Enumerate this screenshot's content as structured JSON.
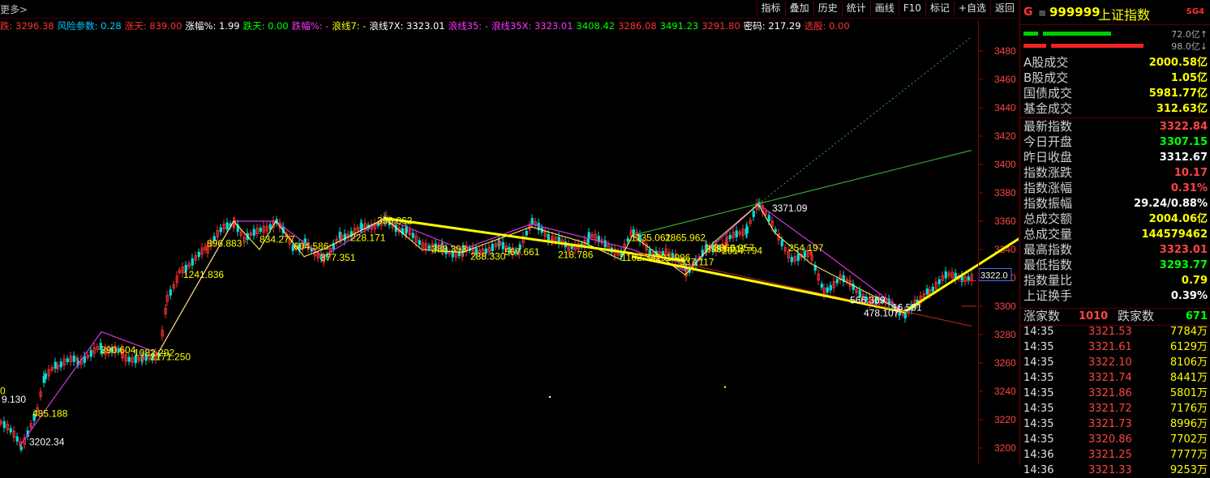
{
  "topbar": {
    "more_label": "更多>",
    "toolbar": [
      "指标",
      "叠加",
      "历史",
      "统计",
      "画线",
      "F10",
      "标记",
      "+自选",
      "返回"
    ]
  },
  "indicator_row": [
    {
      "text": "跌: 3296.38",
      "color": "#ff3333"
    },
    {
      "text": "风险参数: 0.28",
      "color": "#00ccff"
    },
    {
      "text": "涨天: 839.00",
      "color": "#ff3333"
    },
    {
      "text": "涨幅%: 1.99",
      "color": "#ffffff"
    },
    {
      "text": "跌天: 0.00",
      "color": "#00ff00"
    },
    {
      "text": "跌幅%: -",
      "color": "#ff33ff"
    },
    {
      "text": "浪线7: -",
      "color": "#ffff00"
    },
    {
      "text": "浪线7X: 3323.01",
      "color": "#ffffff"
    },
    {
      "text": "浪线35: -",
      "color": "#ff33ff"
    },
    {
      "text": "浪线35X: 3323.01",
      "color": "#ff33ff"
    },
    {
      "text": "3408.42",
      "color": "#00ff00"
    },
    {
      "text": "3286.08",
      "color": "#ff3333"
    },
    {
      "text": "3491.23",
      "color": "#00ff00"
    },
    {
      "text": "3291.80",
      "color": "#ff3333"
    },
    {
      "text": "密码: 217.29",
      "color": "#ffffff"
    },
    {
      "text": "选股: 0.00",
      "color": "#ff3333"
    }
  ],
  "price_axis": {
    "ticks": [
      "3480",
      "3460",
      "3440",
      "3420",
      "3400",
      "3380",
      "3360",
      "3340",
      "3320",
      "3300",
      "3280",
      "3260",
      "3240",
      "3220",
      "3200"
    ],
    "current_label": "3322.0"
  },
  "chart_annotations": [
    "3202.34",
    "485.188",
    "9.130",
    "390.604",
    "1082.292",
    "2171.250",
    "1241.836",
    "896.883",
    "834.277",
    "604.586",
    "377.351",
    "228.171",
    "356.862",
    "388.393",
    "288.330",
    "567.661",
    "218.786",
    "1135.061",
    "1102.341",
    "291.996",
    "2865.962",
    "337.117",
    "3951.917",
    "3868.957",
    "2914.794",
    "3371.09",
    "254.197",
    "566.369",
    "478.107",
    "16.591",
    "0"
  ],
  "panel": {
    "g_label": "G",
    "menu_icon": "≡",
    "code": "999999",
    "name": "上证指数",
    "sg_label": "SG4",
    "bar_up_label": "72.0亿↑",
    "bar_down_label": "98.0亿↓",
    "rows": [
      {
        "label": "A股成交",
        "value": "2000.58亿",
        "color": "#ffff00"
      },
      {
        "label": "B股成交",
        "value": "1.05亿",
        "color": "#ffff00"
      },
      {
        "label": "国债成交",
        "value": "5981.77亿",
        "color": "#ffff00"
      },
      {
        "label": "基金成交",
        "value": "312.63亿",
        "color": "#ffff00"
      },
      {
        "label": "最新指数",
        "value": "3322.84",
        "color": "#ff4444"
      },
      {
        "label": "今日开盘",
        "value": "3307.15",
        "color": "#00ff00"
      },
      {
        "label": "昨日收盘",
        "value": "3312.67",
        "color": "#ffffff"
      },
      {
        "label": "指数涨跌",
        "value": "10.17",
        "color": "#ff4444"
      },
      {
        "label": "指数涨幅",
        "value": "0.31%",
        "color": "#ff4444"
      },
      {
        "label": "指数振幅",
        "value": "29.24/0.88%",
        "color": "#ffffff"
      },
      {
        "label": "总成交额",
        "value": "2004.06亿",
        "color": "#ffff00"
      },
      {
        "label": "总成交量",
        "value": "144579462",
        "color": "#ffff00"
      },
      {
        "label": "最高指数",
        "value": "3323.01",
        "color": "#ff4444"
      },
      {
        "label": "最低指数",
        "value": "3293.77",
        "color": "#00ff00"
      },
      {
        "label": "指数量比",
        "value": "0.79",
        "color": "#ffff00"
      },
      {
        "label": "上证换手",
        "value": "0.39%",
        "color": "#ffffff"
      }
    ],
    "up_label": "涨家数",
    "up_count": "1010",
    "down_label": "跌家数",
    "down_count": "671",
    "ticks": [
      {
        "time": "14:35",
        "price": "3321.53",
        "vol": "7784万"
      },
      {
        "time": "14:35",
        "price": "3321.61",
        "vol": "6129万"
      },
      {
        "time": "14:35",
        "price": "3322.10",
        "vol": "8106万"
      },
      {
        "time": "14:35",
        "price": "3321.74",
        "vol": "8441万"
      },
      {
        "time": "14:35",
        "price": "3321.86",
        "vol": "5801万"
      },
      {
        "time": "14:35",
        "price": "3321.72",
        "vol": "7176万"
      },
      {
        "time": "14:35",
        "price": "3321.73",
        "vol": "8996万"
      },
      {
        "time": "14:35",
        "price": "3320.86",
        "vol": "7702万"
      },
      {
        "time": "14:36",
        "price": "3321.25",
        "vol": "7777万"
      },
      {
        "time": "14:36",
        "price": "3321.33",
        "vol": "9253万"
      }
    ]
  }
}
